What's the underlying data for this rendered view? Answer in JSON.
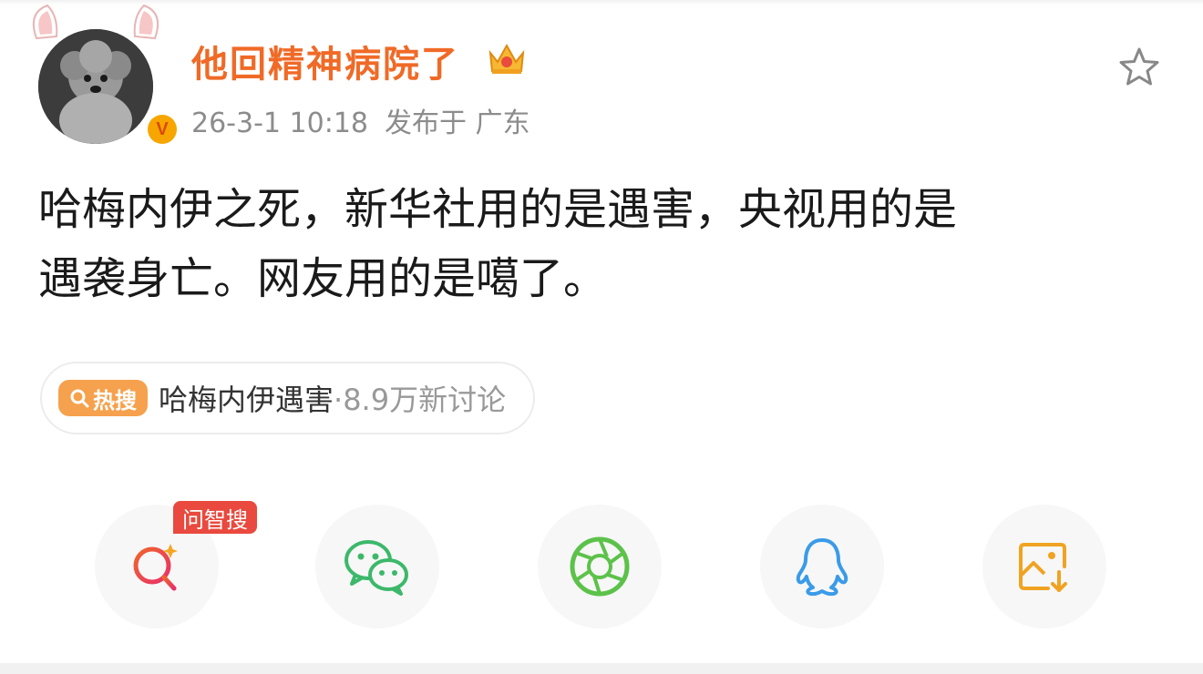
{
  "post": {
    "username": "他回精神病院了",
    "date": "26-3-1 10:18",
    "location": "发布于 广东",
    "text_line1": "哈梅内伊之死，新华社用的是遇害，央视用的是",
    "text_line2": "遇袭身亡。网友用的是噶了。"
  },
  "hot_search": {
    "badge_label": "热搜",
    "topic": "哈梅内伊遇害",
    "stats": "·8.9万新讨论"
  },
  "share": {
    "ai_search_tag": "问智搜",
    "buttons": [
      {
        "icon": "ai-search-icon"
      },
      {
        "icon": "wechat-icon"
      },
      {
        "icon": "moments-icon"
      },
      {
        "icon": "qq-icon"
      },
      {
        "icon": "save-image-icon"
      }
    ]
  },
  "colors": {
    "username": "#f06a27",
    "hot_badge": "#f6a14d",
    "ai_tag": "#e9493e",
    "wechat": "#3cb86b",
    "moments": "#5cc24a",
    "qq": "#3a9be8",
    "save": "#f0a322"
  }
}
